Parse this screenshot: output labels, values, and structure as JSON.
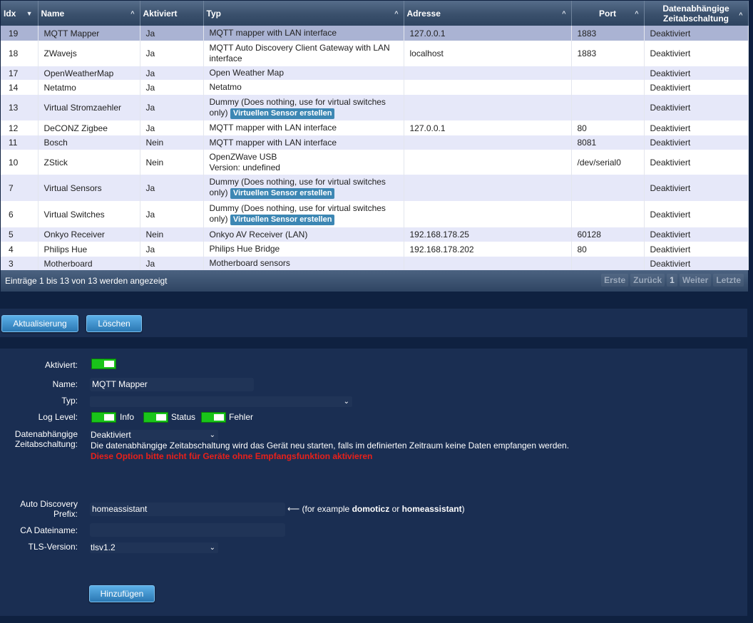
{
  "table": {
    "columns": [
      {
        "label": "Idx",
        "sort": "▼"
      },
      {
        "label": "Name",
        "sort": "^"
      },
      {
        "label": "Aktiviert",
        "sort": ""
      },
      {
        "label": "Typ",
        "sort": "^"
      },
      {
        "label": "Adresse",
        "sort": "^"
      },
      {
        "label": "Port",
        "sort": "^"
      },
      {
        "label_l1": "Datenabhängige",
        "label_l2": "Zeitabschaltung",
        "sort": "^"
      }
    ],
    "rows": [
      {
        "idx": "19",
        "name": "MQTT Mapper",
        "enabled": "Ja",
        "type": "MQTT mapper with LAN interface",
        "type2": "",
        "address": "127.0.0.1",
        "port": "1883",
        "timeout": "Deaktiviert",
        "selected": true,
        "virtual": false
      },
      {
        "idx": "18",
        "name": "ZWavejs",
        "enabled": "Ja",
        "type": "MQTT Auto Discovery Client Gateway with LAN",
        "type2": "interface",
        "address": "localhost",
        "port": "1883",
        "timeout": "Deaktiviert",
        "virtual": false
      },
      {
        "idx": "17",
        "name": "OpenWeatherMap",
        "enabled": "Ja",
        "type": "Open Weather Map",
        "type2": "",
        "address": "",
        "port": "",
        "timeout": "Deaktiviert",
        "virtual": false
      },
      {
        "idx": "14",
        "name": "Netatmo",
        "enabled": "Ja",
        "type": "Netatmo",
        "type2": "",
        "address": "",
        "port": "",
        "timeout": "Deaktiviert",
        "virtual": false
      },
      {
        "idx": "13",
        "name": "Virtual Stromzaehler",
        "enabled": "Ja",
        "type": "Dummy (Does nothing, use for virtual switches",
        "type2": "only)",
        "address": "",
        "port": "",
        "timeout": "Deaktiviert",
        "virtual": true
      },
      {
        "idx": "12",
        "name": "DeCONZ Zigbee",
        "enabled": "Ja",
        "type": "MQTT mapper with LAN interface",
        "type2": "",
        "address": "127.0.0.1",
        "port": "80",
        "timeout": "Deaktiviert",
        "virtual": false
      },
      {
        "idx": "11",
        "name": "Bosch",
        "enabled": "Nein",
        "type": "MQTT mapper with LAN interface",
        "type2": "",
        "address": "",
        "port": "8081",
        "timeout": "Deaktiviert",
        "virtual": false
      },
      {
        "idx": "10",
        "name": "ZStick",
        "enabled": "Nein",
        "type": "OpenZWave USB",
        "type2": "Version: undefined",
        "address": "",
        "port": "/dev/serial0",
        "timeout": "Deaktiviert",
        "virtual": false
      },
      {
        "idx": "7",
        "name": "Virtual Sensors",
        "enabled": "Ja",
        "type": "Dummy (Does nothing, use for virtual switches",
        "type2": "only)",
        "address": "",
        "port": "",
        "timeout": "Deaktiviert",
        "virtual": true
      },
      {
        "idx": "6",
        "name": "Virtual Switches",
        "enabled": "Ja",
        "type": "Dummy (Does nothing, use for virtual switches",
        "type2": "only)",
        "address": "",
        "port": "",
        "timeout": "Deaktiviert",
        "virtual": true
      },
      {
        "idx": "5",
        "name": "Onkyo Receiver",
        "enabled": "Nein",
        "type": "Onkyo AV Receiver (LAN)",
        "type2": "",
        "address": "192.168.178.25",
        "port": "60128",
        "timeout": "Deaktiviert",
        "virtual": false
      },
      {
        "idx": "4",
        "name": "Philips Hue",
        "enabled": "Ja",
        "type": "Philips Hue Bridge",
        "type2": "",
        "address": "192.168.178.202",
        "port": "80",
        "timeout": "Deaktiviert",
        "virtual": false
      },
      {
        "idx": "3",
        "name": "Motherboard",
        "enabled": "Ja",
        "type": "Motherboard sensors",
        "type2": "",
        "address": "",
        "port": "",
        "timeout": "Deaktiviert",
        "virtual": false
      }
    ],
    "virtual_button_label": "Virtuellen Sensor erstellen",
    "footer_info": "Einträge 1 bis 13 von 13 werden angezeigt",
    "pager": {
      "first": "Erste",
      "prev": "Zurück",
      "page": "1",
      "next": "Weiter",
      "last": "Letzte"
    }
  },
  "actions": {
    "update": "Aktualisierung",
    "delete": "Löschen"
  },
  "form": {
    "enabled_label": "Aktiviert:",
    "name_label": "Name:",
    "name_value": "MQTT Mapper",
    "type_label": "Typ:",
    "type_value": "",
    "loglevel_label": "Log Level:",
    "log_info": "Info",
    "log_status": "Status",
    "log_error": "Fehler",
    "timeout_label_l1": "Datenabhängige",
    "timeout_label_l2": "Zeitabschaltung:",
    "timeout_value": "Deaktiviert",
    "timeout_desc": "Die datenabhängige Zeitabschaltung wird das Gerät neu starten, falls im definierten Zeitraum keine Daten empfangen werden.",
    "timeout_warning": "Diese Option bitte nicht für Geräte ohne Empfangsfunktion aktivieren",
    "prefix_label_l1": "Auto Discovery",
    "prefix_label_l2": "Prefix:",
    "prefix_value": "homeassistant",
    "prefix_hint_pre": "⟵ (for example ",
    "prefix_hint_b1": "domoticz",
    "prefix_hint_mid": " or ",
    "prefix_hint_b2": "homeassistant",
    "prefix_hint_post": ")",
    "ca_label": "CA Dateiname:",
    "ca_value": "",
    "tls_label": "TLS-Version:",
    "tls_value": "tlsv1.2",
    "add_button": "Hinzufügen"
  }
}
